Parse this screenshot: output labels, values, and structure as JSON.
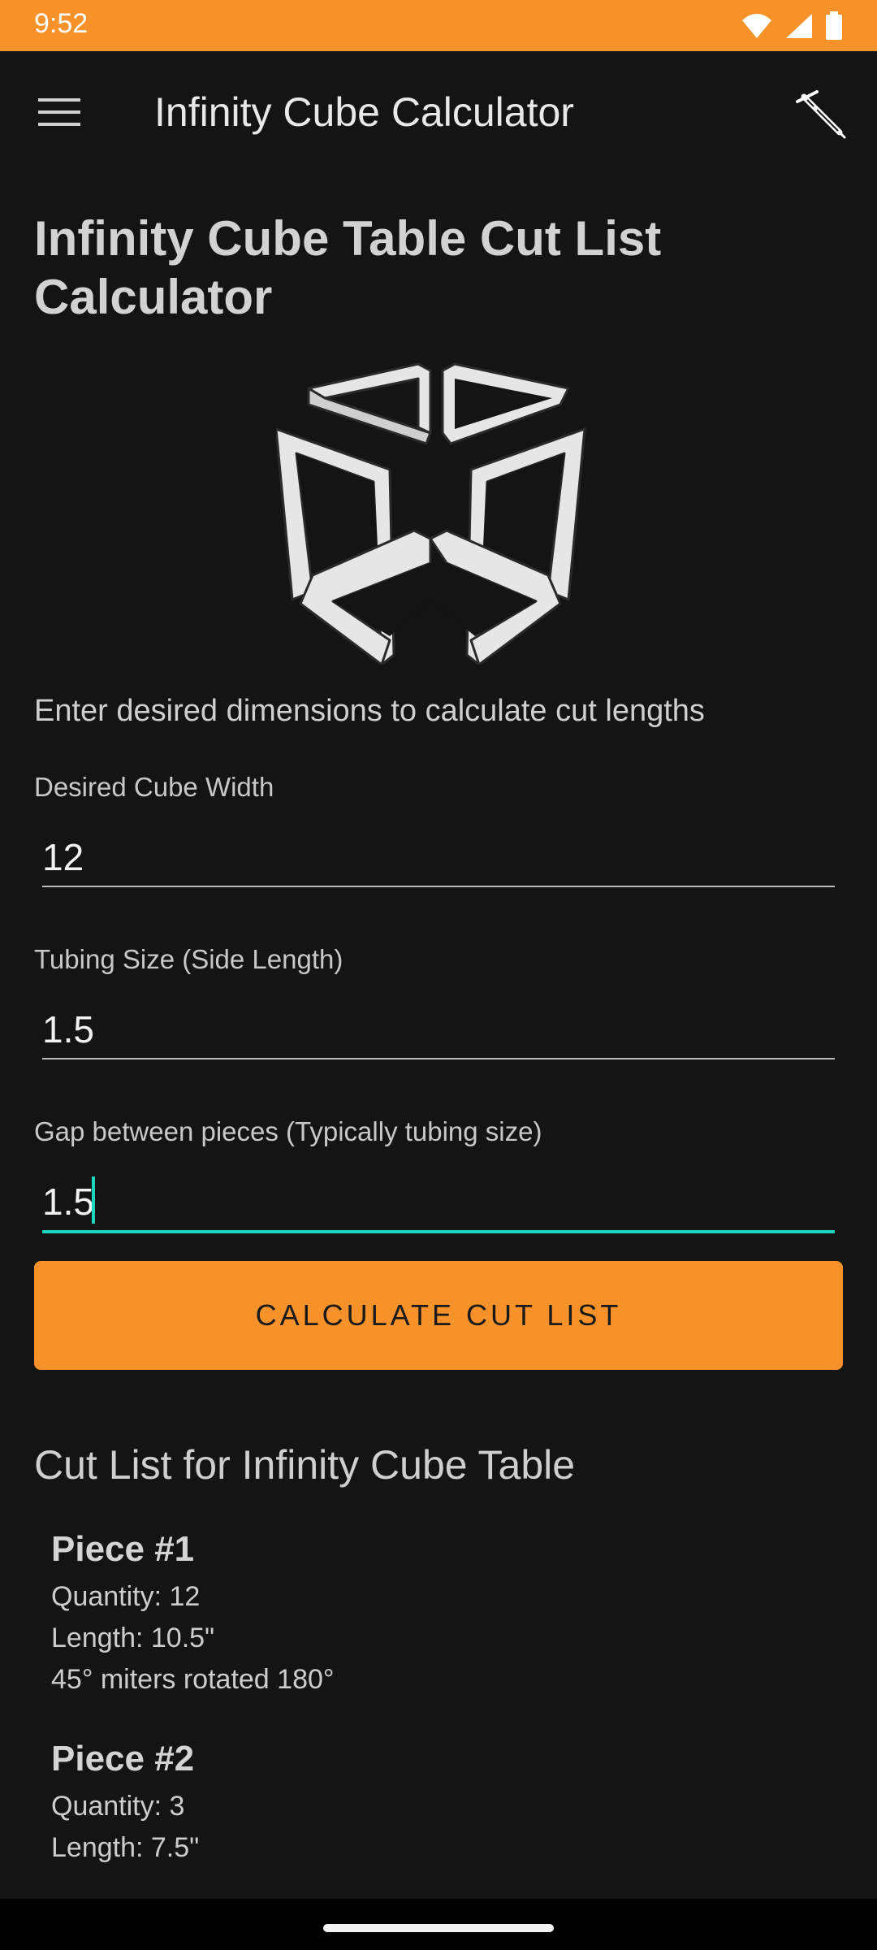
{
  "status_bar": {
    "time": "9:52",
    "icons": [
      "wifi-icon",
      "signal-icon",
      "battery-icon"
    ]
  },
  "app_bar": {
    "title": "Infinity Cube Calculator",
    "menu_icon": "hamburger-menu-icon",
    "action_icon": "welding-torch-icon"
  },
  "main": {
    "heading": "Infinity Cube Table Cut List Calculator",
    "intro": "Enter desired dimensions to calculate cut lengths"
  },
  "form": {
    "width_label": "Desired Cube Width",
    "width_value": "12",
    "tubing_label": "Tubing Size (Side Length)",
    "tubing_value": "1.5",
    "gap_label": "Gap between pieces (Typically tubing size)",
    "gap_value": "1.5",
    "calculate_label": "CALCULATE CUT LIST"
  },
  "results": {
    "heading": "Cut List for Infinity Cube Table",
    "pieces": [
      {
        "title": "Piece #1",
        "quantity": "Quantity: 12",
        "length": "Length: 10.5\"",
        "note": "45° miters rotated 180°"
      },
      {
        "title": "Piece #2",
        "quantity": "Quantity: 3",
        "length": "Length: 7.5\""
      }
    ]
  },
  "colors": {
    "accent": "#f7922a",
    "focus": "#1ed4c0",
    "background": "#141414"
  }
}
